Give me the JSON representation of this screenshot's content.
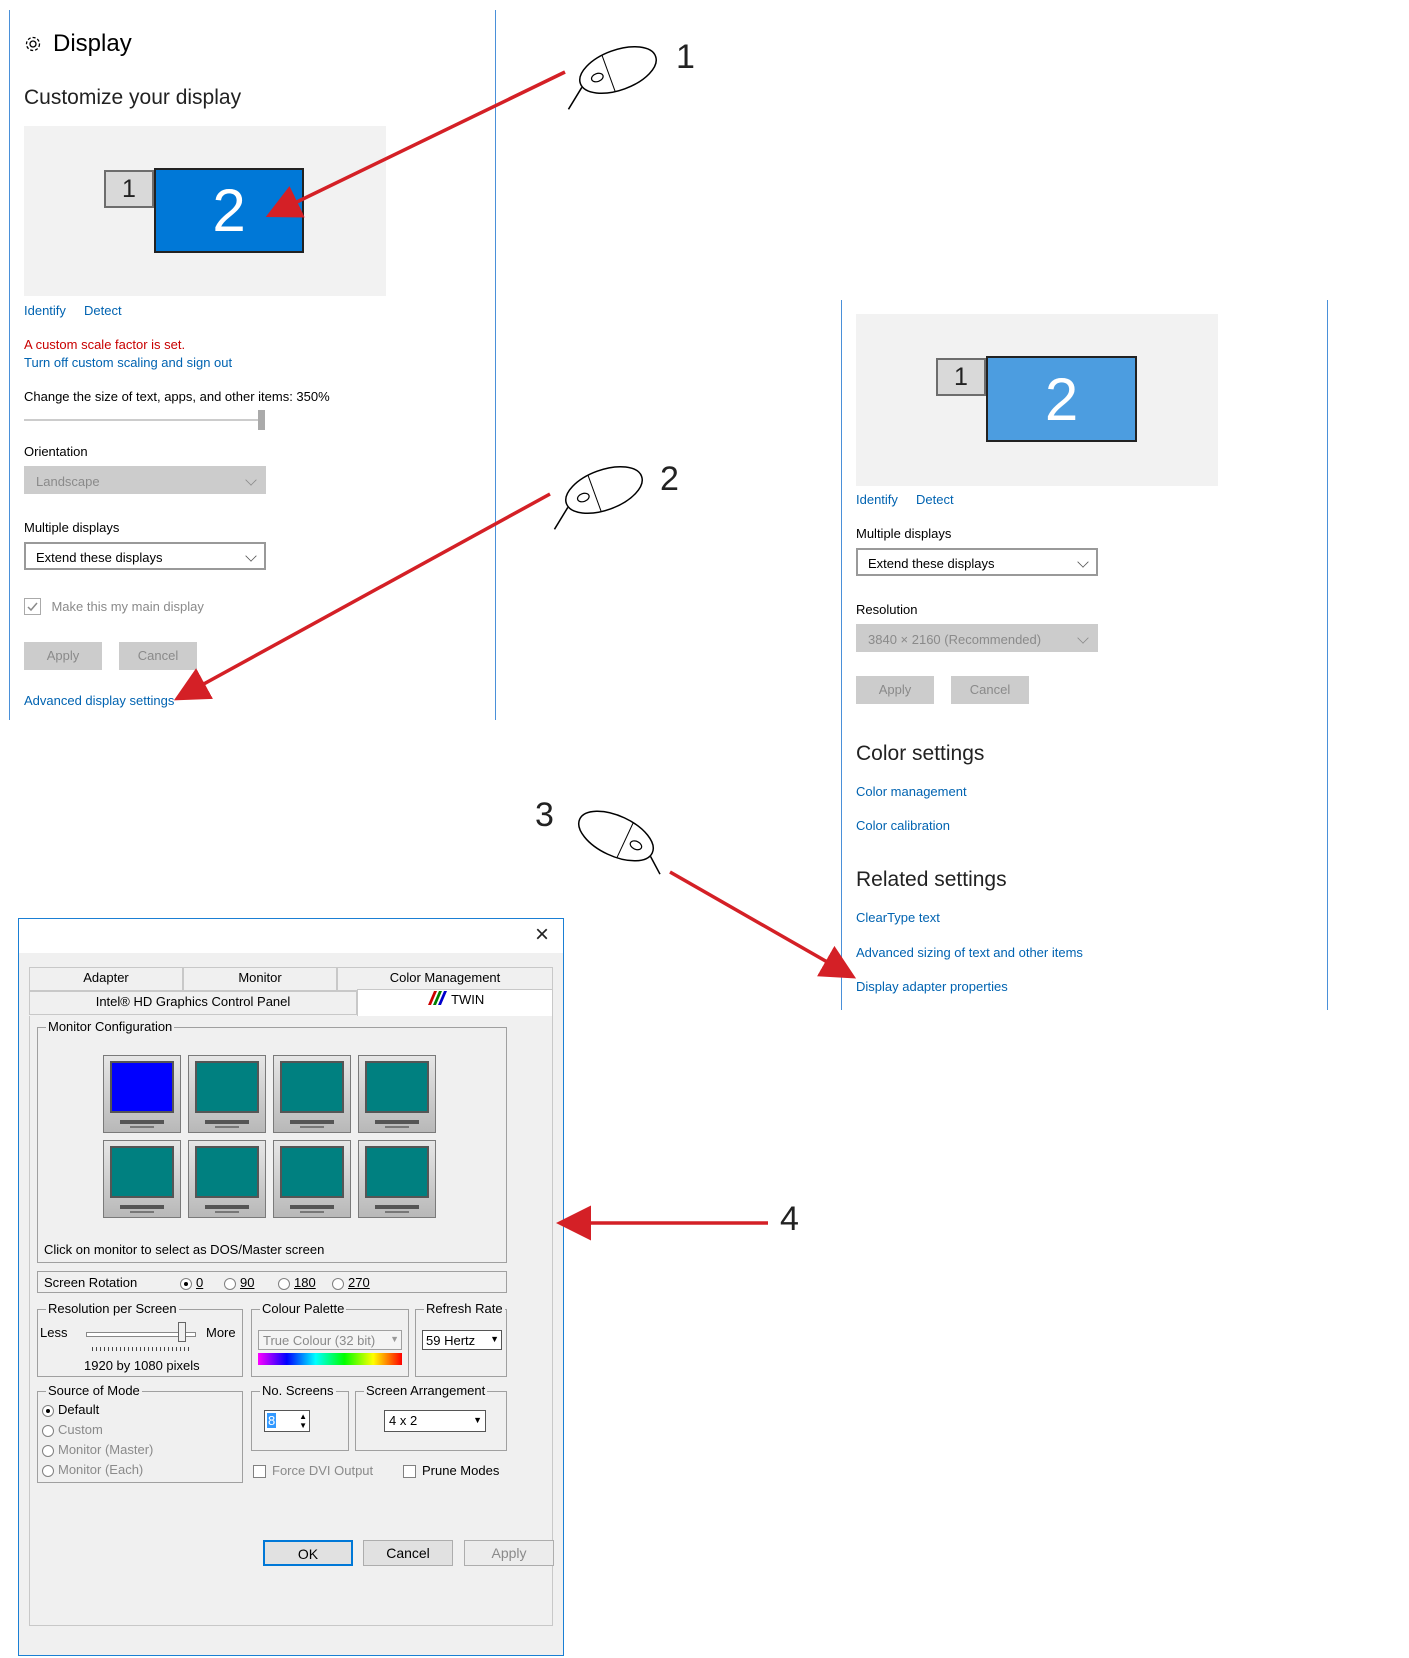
{
  "settings1": {
    "title": "Display",
    "heading": "Customize your display",
    "monitor1": "1",
    "monitor2": "2",
    "identify": "Identify",
    "detect": "Detect",
    "scale_warning": "A custom scale factor is set.",
    "turn_off_link": "Turn off custom scaling and sign out",
    "scale_label": "Change the size of text, apps, and other items: 350%",
    "orientation_label": "Orientation",
    "orientation_value": "Landscape",
    "multiple_label": "Multiple displays",
    "multiple_value": "Extend these displays",
    "main_display": "Make this my main display",
    "apply": "Apply",
    "cancel": "Cancel",
    "advanced_link": "Advanced display settings",
    "accent_color": "#0078d7"
  },
  "settings2": {
    "monitor1": "1",
    "monitor2": "2",
    "identify": "Identify",
    "detect": "Detect",
    "multiple_label": "Multiple displays",
    "multiple_value": "Extend these displays",
    "resolution_label": "Resolution",
    "resolution_value": "3840 × 2160 (Recommended)",
    "apply": "Apply",
    "cancel": "Cancel",
    "color_heading": "Color settings",
    "color_management": "Color management",
    "color_calibration": "Color calibration",
    "related_heading": "Related settings",
    "cleartype": "ClearType text",
    "advanced_sizing": "Advanced sizing of text and other items",
    "adapter_props": "Display adapter properties",
    "accent_color": "#4c9de0"
  },
  "dialog": {
    "close": "×",
    "tabs_row1": [
      "Adapter",
      "Monitor",
      "Color Management"
    ],
    "tabs_row2": [
      "Intel® HD Graphics Control Panel",
      "TWIN"
    ],
    "monitor_config": "Monitor Configuration",
    "select_hint": "Click on monitor to select as DOS/Master screen",
    "rotation_label": "Screen Rotation",
    "rotations": [
      "0",
      "90",
      "180",
      "270"
    ],
    "resolution_group": "Resolution per Screen",
    "less": "Less",
    "more": "More",
    "resolution_value": "1920 by 1080 pixels",
    "palette_group": "Colour Palette",
    "palette_value": "True Colour (32 bit)",
    "refresh_group": "Refresh Rate",
    "refresh_value": "59 Hertz",
    "source_group": "Source of Mode",
    "sources": [
      "Default",
      "Custom",
      "Monitor (Master)",
      "Monitor (Each)"
    ],
    "screens_group": "No. Screens",
    "screens_value": "8",
    "arrangement_group": "Screen Arrangement",
    "arrangement_value": "4 x 2",
    "force_dvi": "Force DVI Output",
    "prune_modes": "Prune Modes",
    "ok": "OK",
    "cancel": "Cancel",
    "apply": "Apply",
    "selected_monitor_color": "#0000ff",
    "monitor_color": "#008080"
  },
  "callouts": [
    "1",
    "2",
    "3",
    "4"
  ]
}
